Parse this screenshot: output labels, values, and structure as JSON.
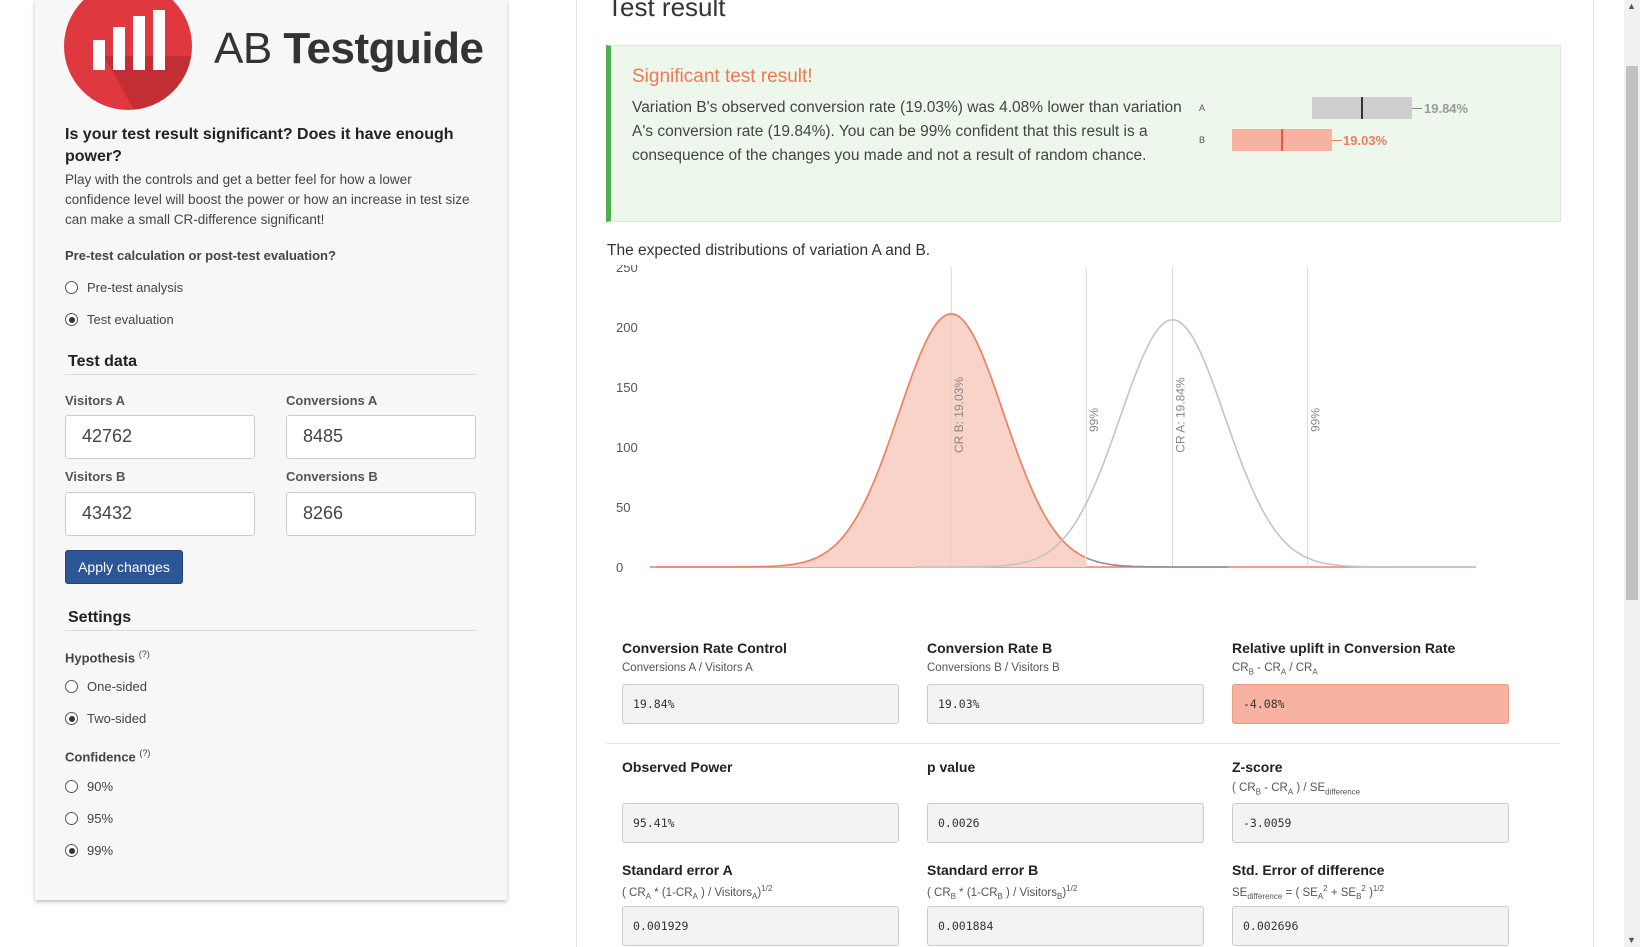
{
  "logo": {
    "text_light": "AB ",
    "text_bold": "Testguide"
  },
  "left": {
    "question": "Is your test result significant? Does it have enough power?",
    "description": "Play with the controls and get a better feel for how a lower confidence level will boost the power or how an increase in test size can make a small CR-difference significant!",
    "mode_label": "Pre-test calculation or post-test evaluation?",
    "mode_options": [
      {
        "label": "Pre-test analysis",
        "selected": false
      },
      {
        "label": "Test evaluation",
        "selected": true
      }
    ],
    "test_data_heading": "Test data",
    "fields": {
      "visitors_a_label": "Visitors A",
      "visitors_a": "42762",
      "conversions_a_label": "Conversions A",
      "conversions_a": "8485",
      "visitors_b_label": "Visitors B",
      "visitors_b": "43432",
      "conversions_b_label": "Conversions B",
      "conversions_b": "8266"
    },
    "apply_label": "Apply changes",
    "settings_heading": "Settings",
    "hypothesis_label": "Hypothesis",
    "help_marker": "(?)",
    "hypothesis_options": [
      {
        "label": "One-sided",
        "selected": false
      },
      {
        "label": "Two-sided",
        "selected": true
      }
    ],
    "confidence_label": "Confidence",
    "confidence_options": [
      {
        "label": "90%",
        "selected": false
      },
      {
        "label": "95%",
        "selected": false
      },
      {
        "label": "99%",
        "selected": true
      }
    ]
  },
  "result": {
    "title": "Test result",
    "alert_title": "Significant test result!",
    "alert_body": "Variation B's observed conversion rate (19.03%) was 4.08% lower than variation A's conversion rate (19.84%). You can be 99% confident that this result is a consequence of the changes you made and not a result of random chance.",
    "mini_a_label": "A",
    "mini_a_value": "19.84%",
    "mini_b_label": "B",
    "mini_b_value": "19.03%",
    "distribution_title": "The expected distributions of variation A and B.",
    "colors": {
      "variation_b": "#f07b5f",
      "variation_a": "#c4c4c4",
      "success": "#4cae4c"
    }
  },
  "chart_data": {
    "type": "area",
    "yticks": [
      "250",
      "200",
      "150",
      "100",
      "50",
      "0"
    ],
    "ylim": [
      0,
      250
    ],
    "series": [
      {
        "name": "CR B: 19.03%",
        "mean": 19.03,
        "peak": 211,
        "confidence_line_label": "99%"
      },
      {
        "name": "CR A: 19.84%",
        "mean": 19.84,
        "peak": 206,
        "confidence_line_label": "99%"
      }
    ]
  },
  "stats": {
    "cr_control_title": "Conversion Rate Control",
    "cr_control_value": "19.84%",
    "cr_b_title": "Conversion Rate B",
    "cr_b_value": "19.03%",
    "uplift_title": "Relative uplift in Conversion Rate",
    "uplift_value": "-4.08%",
    "power_title": "Observed Power",
    "power_value": "95.41%",
    "p_title": "p value",
    "p_value": "0.0026",
    "z_title": "Z-score",
    "z_value": "-3.0059",
    "se_a_title": "Standard error A",
    "se_a_value": "0.001929",
    "se_b_title": "Standard error B",
    "se_b_value": "0.001884",
    "se_diff_title": "Std. Error of difference",
    "se_diff_value": "0.002696"
  }
}
